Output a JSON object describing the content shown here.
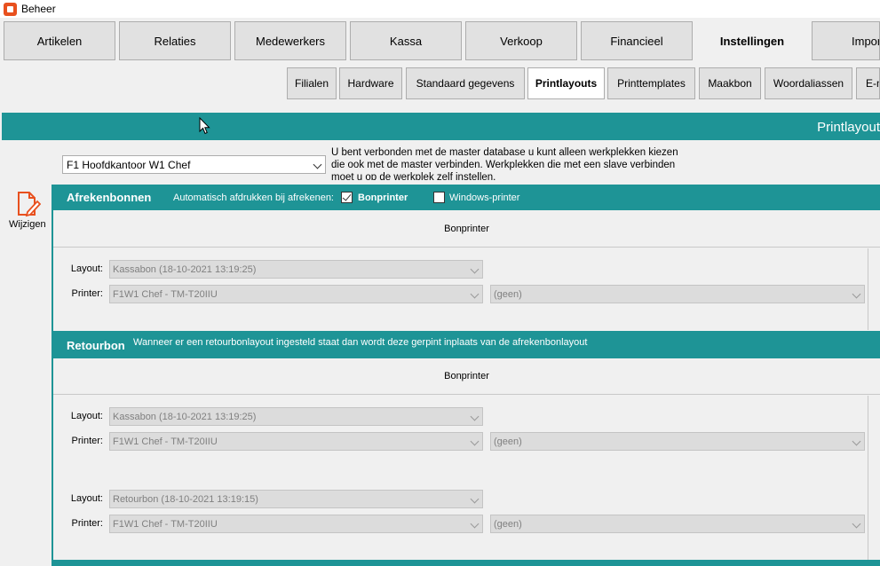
{
  "window": {
    "title": "Beheer"
  },
  "main_tabs": [
    {
      "label": "Artikelen"
    },
    {
      "label": "Relaties"
    },
    {
      "label": "Medewerkers"
    },
    {
      "label": "Kassa"
    },
    {
      "label": "Verkoop"
    },
    {
      "label": "Financieel"
    },
    {
      "label": "Instellingen",
      "active": true
    },
    {
      "label": "Impor"
    }
  ],
  "sub_tabs": [
    {
      "label": "Filialen"
    },
    {
      "label": "Hardware"
    },
    {
      "label": "Standaard gegevens"
    },
    {
      "label": "Printlayouts",
      "active": true
    },
    {
      "label": "Printtemplates"
    },
    {
      "label": "Maakbon"
    },
    {
      "label": "Woordaliassen"
    },
    {
      "label": "E-m"
    }
  ],
  "header": {
    "title": "Printlayout"
  },
  "location": {
    "selected": "F1 Hoofdkantoor W1 Chef"
  },
  "info_text": "U bent verbonden met de master database u kunt alleen werkplekken kiezen die ook met de master verbinden. Werkplekken die met een slave verbinden moet u op de werkplek zelf instellen.",
  "edit": {
    "label": "Wijzigen"
  },
  "afrekenbonnen": {
    "title": "Afrekenbonnen",
    "auto_print_label": "Automatisch afdrukken bij afrekenen:",
    "bonprinter_label": "Bonprinter",
    "bonprinter_checked": true,
    "windows_printer_label": "Windows-printer",
    "windows_printer_checked": false,
    "panel_header": "Bonprinter",
    "layout_label": "Layout:",
    "layout_value": "Kassabon (18-10-2021 13:19:25)",
    "printer_label": "Printer:",
    "printer_value": "F1W1 Chef - TM-T20IIU",
    "printer2_value": "(geen)"
  },
  "retourbon": {
    "title": "Retourbon",
    "description": "Wanneer er een retourbonlayout ingesteld staat dan wordt deze gerpint inplaats van de afrekenbonlayout",
    "panel_header": "Bonprinter",
    "layout_label": "Layout:",
    "layout_value": "Kassabon (18-10-2021 13:19:25)",
    "printer_label": "Printer:",
    "printer_value": "F1W1 Chef - TM-T20IIU",
    "printer2_value": "(geen)",
    "layout2_label": "Layout:",
    "layout2_value": "Retourbon (18-10-2021 13:19:15)",
    "printer3_label": "Printer:",
    "printer3_value": "F1W1 Chef - TM-T20IIU",
    "printer4_value": "(geen)"
  }
}
